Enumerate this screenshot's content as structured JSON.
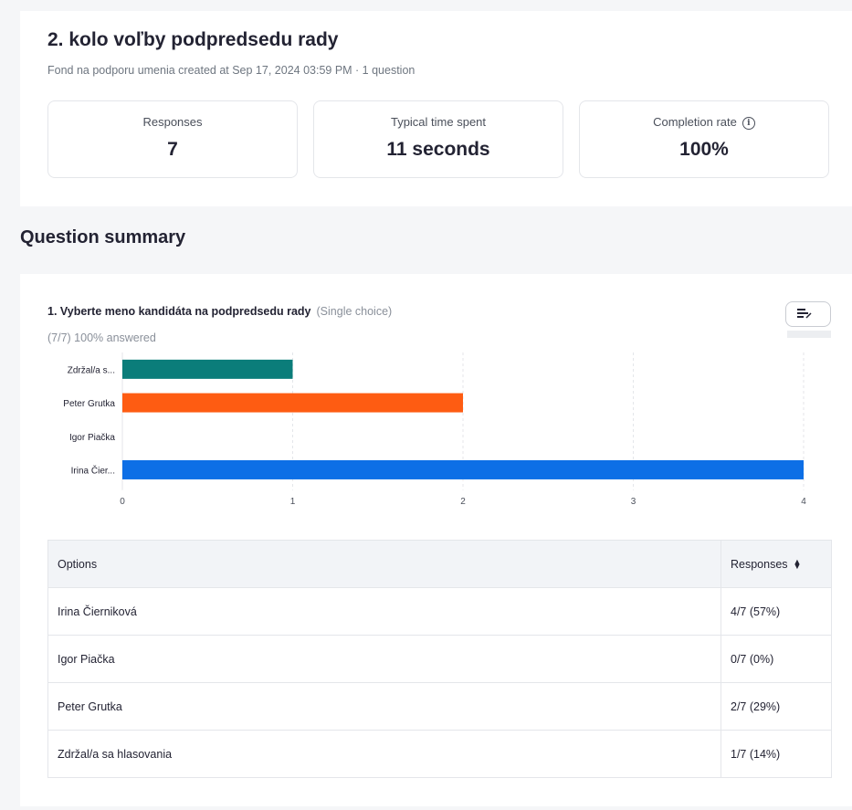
{
  "survey": {
    "title": "2. kolo voľby podpredsedu rady",
    "subtitle": "Fond na podporu umenia created at Sep 17, 2024 03:59 PM · 1 question"
  },
  "stats": [
    {
      "label": "Responses",
      "value": "7"
    },
    {
      "label": "Typical time spent",
      "value": "11 seconds"
    },
    {
      "label": "Completion rate",
      "value": "100%"
    }
  ],
  "section_title": "Question summary",
  "question": {
    "title": "1. Vyberte meno kandidáta na podpredsedu rady",
    "type": "(Single choice)",
    "answered": "(7/7) 100% answered"
  },
  "icons": {
    "completion_info": "info-icon",
    "chart_type": "bar-chart-icon",
    "sort": "sort-icon"
  },
  "chart_data": {
    "type": "bar",
    "orientation": "horizontal",
    "categories": [
      "Zdržal/a s...",
      "Peter Grutka",
      "Igor Piačka",
      "Irina Čier..."
    ],
    "values": [
      1,
      2,
      0,
      4
    ],
    "colors": [
      "#0b7d7a",
      "#fe5c12",
      "#8a8a8a",
      "#0d6fe6"
    ],
    "xlim": [
      0,
      4
    ],
    "xticks": [
      "0",
      "1",
      "2",
      "3",
      "4"
    ],
    "grid": true
  },
  "table": {
    "headers": [
      "Options",
      "Responses"
    ],
    "rows": [
      [
        "Irina Čierniková",
        "4/7 (57%)"
      ],
      [
        "Igor Piačka",
        "0/7 (0%)"
      ],
      [
        "Peter Grutka",
        "2/7 (29%)"
      ],
      [
        "Zdržal/a sa hlasovania",
        "1/7 (14%)"
      ]
    ]
  }
}
